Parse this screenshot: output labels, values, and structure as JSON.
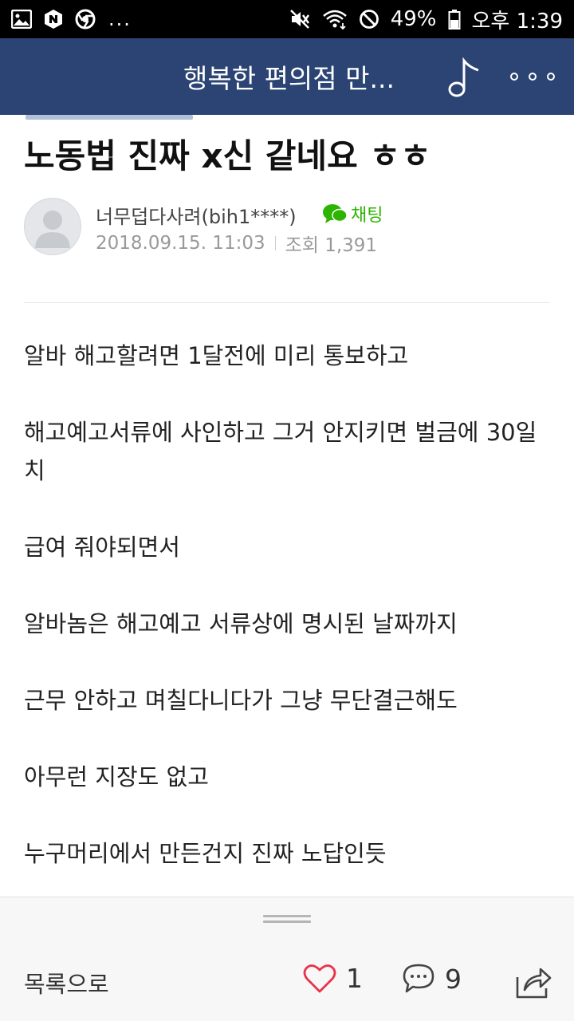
{
  "status_bar": {
    "more": "...",
    "battery": "49%",
    "time": "오후 1:39"
  },
  "header": {
    "title": "행복한 편의점 만..."
  },
  "post": {
    "title": "노동법 진짜 x신 같네요 ㅎㅎ",
    "author": "너무덥다사려(bih1****)",
    "chat_label": "채팅",
    "date": "2018.09.15. 11:03",
    "views": "조회 1,391",
    "paragraphs": [
      "알바 해고할려면 1달전에 미리 통보하고",
      "해고예고서류에 사인하고 그거  안지키면 벌금에 30일치",
      "급여 줘야되면서",
      "알바놈은 해고예고 서류상에 명시된 날짜까지",
      "근무 안하고 며칠다니다가 그냥 무단결근해도",
      "아무런 지장도 없고",
      "누구머리에서 만든건지 진짜 노답인듯"
    ]
  },
  "bottom": {
    "list_label": "목록으로",
    "likes": "1",
    "comments": "9"
  },
  "colors": {
    "header_bg": "#2b4473",
    "chat_green": "#2db400",
    "like_red": "#e8334a"
  },
  "icons": [
    "gallery-icon",
    "naver-icon",
    "chrome-icon",
    "mute-icon",
    "wifi-icon",
    "block-icon",
    "battery-icon",
    "music-note-icon",
    "more-icon",
    "chat-icon",
    "heart-icon",
    "comment-icon",
    "share-icon"
  ]
}
